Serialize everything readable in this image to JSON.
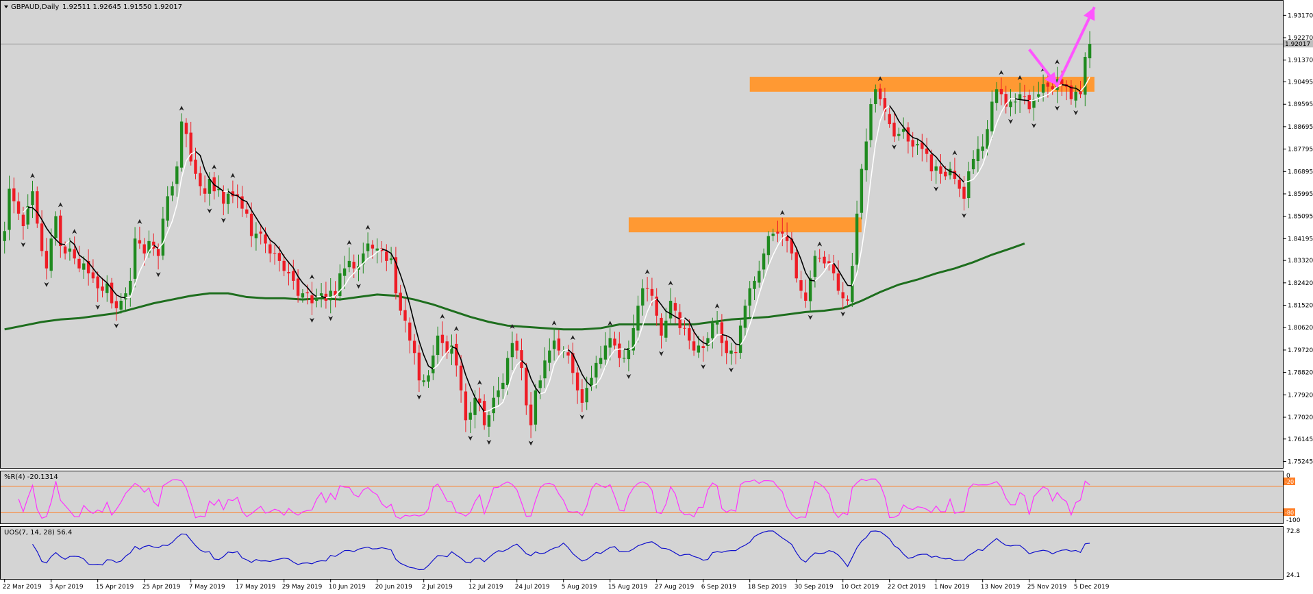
{
  "header": {
    "symbol_timeframe": "GBPAUD,Daily",
    "ohlc": "1.92511 1.92645 1.91550 1.92017"
  },
  "colors": {
    "background": "#d4d4d4",
    "bull_candle": "#1f8a1f",
    "bear_candle": "#ee1c25",
    "ma_long": "#1e6e1e",
    "ma_short_up": "#ffffff",
    "ma_short_down": "#000000",
    "zone": "#ff9933",
    "arrow": "#ff55ff",
    "wpr_line": "#ff33ff",
    "wpr_levels": "#ff7f27",
    "uos_line": "#1010cc",
    "price_tag_bg": "#bfbfbf"
  },
  "chart_data": {
    "type": "candlestick",
    "price_axis_labels": [
      "1.93170",
      "1.92270",
      "1.91370",
      "1.90495",
      "1.89595",
      "1.88695",
      "1.87795",
      "1.86895",
      "1.85995",
      "1.85095",
      "1.84195",
      "1.83320",
      "1.82420",
      "1.81520",
      "1.80620",
      "1.79720",
      "1.78820",
      "1.77920",
      "1.77020",
      "1.76145",
      "1.75245"
    ],
    "price_range": [
      1.7501,
      1.9351
    ],
    "current_price": "1.92017",
    "date_labels": [
      "22 Mar 2019",
      "3 Apr 2019",
      "15 Apr 2019",
      "25 Apr 2019",
      "7 May 2019",
      "17 May 2019",
      "29 May 2019",
      "10 Jun 2019",
      "20 Jun 2019",
      "2 Jul 2019",
      "12 Jul 2019",
      "24 Jul 2019",
      "5 Aug 2019",
      "15 Aug 2019",
      "27 Aug 2019",
      "6 Sep 2019",
      "18 Sep 2019",
      "30 Sep 2019",
      "10 Oct 2019",
      "22 Oct 2019",
      "1 Nov 2019",
      "13 Nov 2019",
      "25 Nov 2019",
      "5 Dec 2019"
    ],
    "closes": [
      1.845,
      1.862,
      1.857,
      1.852,
      1.847,
      1.855,
      1.861,
      1.848,
      1.837,
      1.83,
      1.842,
      1.851,
      1.839,
      1.836,
      1.838,
      1.834,
      1.83,
      1.832,
      1.828,
      1.826,
      1.822,
      1.821,
      1.824,
      1.816,
      1.814,
      1.817,
      1.82,
      1.825,
      1.842,
      1.84,
      1.836,
      1.841,
      1.838,
      1.835,
      1.85,
      1.859,
      1.863,
      1.871,
      1.889,
      1.884,
      1.873,
      1.868,
      1.863,
      1.86,
      1.866,
      1.861,
      1.862,
      1.856,
      1.86,
      1.859,
      1.859,
      1.854,
      1.852,
      1.843,
      1.844,
      1.844,
      1.84,
      1.836,
      1.836,
      1.833,
      1.829,
      1.828,
      1.825,
      1.819,
      1.82,
      1.82,
      1.816,
      1.818,
      1.82,
      1.817,
      1.821,
      1.819,
      1.828,
      1.83,
      1.833,
      1.83,
      1.831,
      1.836,
      1.84,
      1.838,
      1.838,
      1.837,
      1.833,
      1.834,
      1.82,
      1.813,
      1.809,
      1.801,
      1.796,
      1.785,
      1.785,
      1.787,
      1.795,
      1.803,
      1.8,
      1.796,
      1.799,
      1.791,
      1.781,
      1.769,
      1.772,
      1.778,
      1.776,
      1.767,
      1.771,
      1.778,
      1.781,
      1.784,
      1.794,
      1.8,
      1.797,
      1.79,
      1.775,
      1.767,
      1.781,
      1.785,
      1.793,
      1.797,
      1.801,
      1.797,
      1.797,
      1.795,
      1.788,
      1.781,
      1.776,
      1.782,
      1.786,
      1.792,
      1.794,
      1.799,
      1.802,
      1.799,
      1.794,
      1.794,
      1.798,
      1.806,
      1.815,
      1.822,
      1.822,
      1.819,
      1.811,
      1.803,
      1.809,
      1.817,
      1.813,
      1.806,
      1.806,
      1.801,
      1.797,
      1.799,
      1.798,
      1.802,
      1.808,
      1.809,
      1.8,
      1.796,
      1.797,
      1.796,
      1.807,
      1.815,
      1.822,
      1.825,
      1.829,
      1.836,
      1.843,
      1.844,
      1.844,
      1.844,
      1.841,
      1.836,
      1.826,
      1.821,
      1.817,
      1.826,
      1.835,
      1.834,
      1.832,
      1.832,
      1.828,
      1.821,
      1.818,
      1.817,
      1.831,
      1.852,
      1.87,
      1.881,
      1.896,
      1.902,
      1.898,
      1.893,
      1.888,
      1.883,
      1.884,
      1.886,
      1.881,
      1.879,
      1.88,
      1.878,
      1.876,
      1.869,
      1.871,
      1.868,
      1.867,
      1.87,
      1.866,
      1.862,
      1.858,
      1.869,
      1.874,
      1.878,
      1.879,
      1.886,
      1.897,
      1.902,
      1.9,
      1.895,
      1.897,
      1.897,
      1.9,
      1.899,
      1.894,
      1.898,
      1.9,
      1.904,
      1.903,
      1.902,
      1.906,
      1.904,
      1.903,
      1.898,
      1.901,
      1.9,
      1.915,
      1.9202
    ],
    "moving_average_long": [
      [
        0,
        1.8055
      ],
      [
        4,
        1.807
      ],
      [
        8,
        1.8085
      ],
      [
        12,
        1.8095
      ],
      [
        16,
        1.81
      ],
      [
        20,
        1.811
      ],
      [
        24,
        1.812
      ],
      [
        28,
        1.814
      ],
      [
        32,
        1.816
      ],
      [
        36,
        1.8175
      ],
      [
        40,
        1.819
      ],
      [
        44,
        1.82
      ],
      [
        48,
        1.82
      ],
      [
        52,
        1.8185
      ],
      [
        56,
        1.818
      ],
      [
        60,
        1.818
      ],
      [
        64,
        1.8175
      ],
      [
        68,
        1.818
      ],
      [
        72,
        1.8175
      ],
      [
        76,
        1.8185
      ],
      [
        80,
        1.8195
      ],
      [
        84,
        1.819
      ],
      [
        88,
        1.8175
      ],
      [
        92,
        1.8155
      ],
      [
        96,
        1.813
      ],
      [
        100,
        1.8105
      ],
      [
        104,
        1.8085
      ],
      [
        108,
        1.807
      ],
      [
        112,
        1.8065
      ],
      [
        116,
        1.806
      ],
      [
        120,
        1.8055
      ],
      [
        124,
        1.8055
      ],
      [
        128,
        1.806
      ],
      [
        132,
        1.8075
      ],
      [
        136,
        1.8075
      ],
      [
        140,
        1.8075
      ],
      [
        144,
        1.8075
      ],
      [
        148,
        1.8075
      ],
      [
        152,
        1.8085
      ],
      [
        156,
        1.8095
      ],
      [
        160,
        1.81
      ],
      [
        164,
        1.8105
      ],
      [
        168,
        1.8115
      ],
      [
        172,
        1.8125
      ],
      [
        176,
        1.813
      ],
      [
        180,
        1.814
      ],
      [
        184,
        1.817
      ],
      [
        188,
        1.8205
      ],
      [
        192,
        1.8235
      ],
      [
        196,
        1.8255
      ],
      [
        200,
        1.828
      ],
      [
        204,
        1.83
      ],
      [
        208,
        1.8325
      ],
      [
        212,
        1.8355
      ],
      [
        216,
        1.838
      ],
      [
        219,
        1.84
      ]
    ],
    "zones": [
      {
        "name": "upper-resistance-zone",
        "from_bar": 160,
        "to_bar": 234,
        "low": 1.901,
        "high": 1.907
      },
      {
        "name": "lower-support-zone",
        "from_bar": 134,
        "to_bar": 184,
        "low": 1.8445,
        "high": 1.8505
      }
    ],
    "projection": [
      [
        220,
        1.918
      ],
      [
        226,
        1.9035
      ],
      [
        234,
        1.935
      ]
    ],
    "ylim": [
      1.7501,
      1.9351
    ]
  },
  "wpr": {
    "label": "%R(4) -20.1314",
    "axis_top": "0",
    "axis_bottom": "-100",
    "level_high_tag": "-20",
    "level_low_tag": "-80",
    "levels": [
      -20,
      -80
    ],
    "ylim": [
      -100,
      0
    ]
  },
  "uos": {
    "label": "UOS(7, 14, 28) 56.4",
    "axis_top": "72.8",
    "axis_bottom": "24.1",
    "ylim": [
      24.1,
      72.8
    ]
  }
}
